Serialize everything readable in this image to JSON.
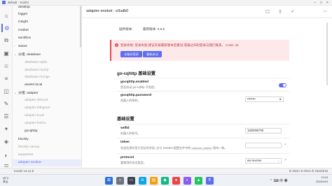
{
  "window": {
    "title": "default - Koishi"
  },
  "activity_bar": {
    "icons": [
      "home-icon",
      "plugin-config-icon",
      "dependencies-icon",
      "market-icon",
      "user-icon",
      "database-icon",
      "bot-icon",
      "chat-icon",
      "logs-icon",
      "settings-icon",
      "sandbox-icon",
      "dark-mode-icon",
      "menu-icon"
    ]
  },
  "sidebar": {
    "items": [
      {
        "label": "desktop",
        "kind": "plugin",
        "state": "enabled"
      },
      {
        "label": "logger",
        "kind": "plugin",
        "state": "enabled"
      },
      {
        "label": "insight",
        "kind": "plugin",
        "state": "enabled"
      },
      {
        "label": "market",
        "kind": "plugin",
        "state": "enabled"
      },
      {
        "label": "sandbox",
        "kind": "plugin",
        "state": "enabled"
      },
      {
        "label": "status",
        "kind": "group",
        "state": "enabled"
      },
      {
        "label": "分组: database",
        "kind": "group",
        "state": "enabled"
      },
      {
        "label": "database-sqlite",
        "kind": "plugin",
        "state": "disabled"
      },
      {
        "label": "database-mysql",
        "kind": "plugin",
        "state": "disabled"
      },
      {
        "label": "database-mongo",
        "kind": "plugin",
        "state": "disabled"
      },
      {
        "label": "assets-local",
        "kind": "plugin",
        "state": "enabled"
      },
      {
        "label": "分组: adapter",
        "kind": "group",
        "state": "enabled"
      },
      {
        "label": "adapter-discord",
        "kind": "plugin",
        "state": "disabled"
      },
      {
        "label": "adapter-telegram",
        "kind": "plugin",
        "state": "disabled"
      },
      {
        "label": "adapter-kook",
        "kind": "plugin",
        "state": "disabled"
      },
      {
        "label": "adapter-feishu",
        "kind": "plugin",
        "state": "disabled"
      },
      {
        "label": "gocqhttp",
        "kind": "plugin",
        "state": "enabled"
      },
      {
        "label": "blockly",
        "kind": "plugin",
        "state": "enabled"
      },
      {
        "label": "blockly-canary",
        "kind": "plugin",
        "state": "disabled"
      },
      {
        "label": "puppeteer",
        "kind": "plugin",
        "state": "disabled"
      },
      {
        "label": "adapter-onebot",
        "kind": "plugin",
        "state": "active"
      }
    ]
  },
  "header": {
    "plugin_name": "adapter-onebot : o3udb0",
    "actions": [
      "save-icon",
      "stop-icon",
      "check-icon",
      "more-icon"
    ]
  },
  "versions": {
    "label": "插件版本:",
    "value": "最新版本: 5.6.6"
  },
  "alert": {
    "message": "登录失败: 登录失败,建议升级最新版本后重试,或通过扫码登录与我们联系。 Code: 45",
    "buttons": [
      "去备份登录",
      "重新启动"
    ]
  },
  "sections": [
    {
      "title": "go-cqhttp 基础设置",
      "fields": [
        {
          "name": "gocqhttp.enabled",
          "desc": "是否启动 go-cqhttp 子进程。",
          "control": "toggle",
          "value": true
        },
        {
          "name": "gocqhttp.password",
          "desc": "机器人的密码。",
          "control": "password",
          "value": "••••••••"
        }
      ]
    },
    {
      "title": "基础设置",
      "fields": [
        {
          "name": "selfId",
          "desc": "机器人的账号。",
          "control": "input",
          "value": "1826055706"
        },
        {
          "name": "token",
          "desc": "发送信息时用于验证的字段, 应与 OneBot 配置文件中的",
          "code": "access_token",
          "desc_tail": "保持一致。",
          "control": "input",
          "value": ""
        },
        {
          "name": "protocol",
          "desc": "要使用的协议类型。",
          "control": "select",
          "value": "ws-reverse"
        }
      ]
    }
  ],
  "statusbar": {
    "version": "Koishi v4.12.5",
    "info": "⇅ 0/min  ⇅ 0/min  ⏱ 2023/4/18"
  },
  "taskbar": {
    "weather_temp": "26°C",
    "weather_desc": "多云",
    "clock_time": "12:15",
    "clock_date": "2023/4/19"
  }
}
